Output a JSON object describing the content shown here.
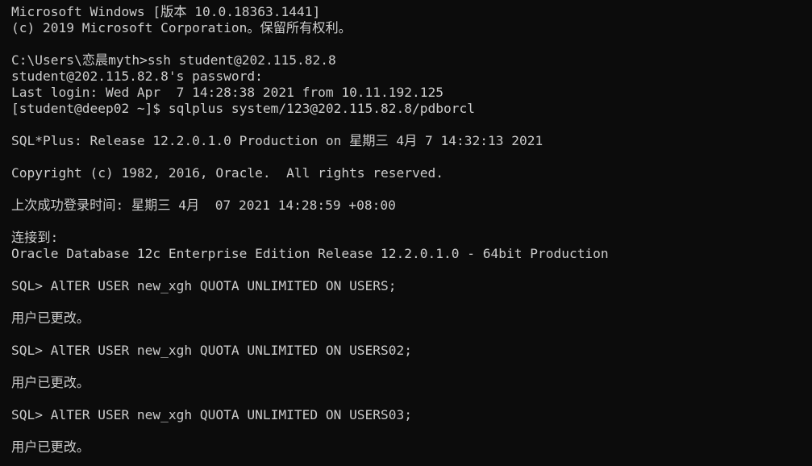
{
  "terminal": {
    "lines": [
      "Microsoft Windows [版本 10.0.18363.1441]",
      "(c) 2019 Microsoft Corporation。保留所有权利。",
      "",
      "C:\\Users\\恋晨myth>ssh student@202.115.82.8",
      "student@202.115.82.8's password:",
      "Last login: Wed Apr  7 14:28:38 2021 from 10.11.192.125",
      "[student@deep02 ~]$ sqlplus system/123@202.115.82.8/pdborcl",
      "",
      "SQL*Plus: Release 12.2.0.1.0 Production on 星期三 4月 7 14:32:13 2021",
      "",
      "Copyright (c) 1982, 2016, Oracle.  All rights reserved.",
      "",
      "上次成功登录时间: 星期三 4月  07 2021 14:28:59 +08:00",
      "",
      "连接到:",
      "Oracle Database 12c Enterprise Edition Release 12.2.0.1.0 - 64bit Production",
      "",
      "SQL> AlTER USER new_xgh QUOTA UNLIMITED ON USERS;",
      "",
      "用户已更改。",
      "",
      "SQL> AlTER USER new_xgh QUOTA UNLIMITED ON USERS02;",
      "",
      "用户已更改。",
      "",
      "SQL> AlTER USER new_xgh QUOTA UNLIMITED ON USERS03;",
      "",
      "用户已更改。"
    ]
  }
}
